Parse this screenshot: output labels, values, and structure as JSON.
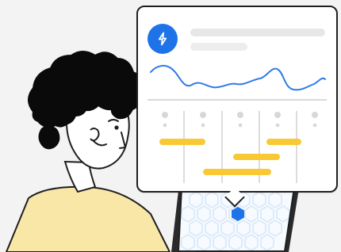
{
  "illustration": {
    "card": {
      "header": {
        "icon": "lightning-bolt-icon",
        "accent": "#1e73e8"
      },
      "chart": {
        "line_color": "#2f7bea",
        "baseline_color": "#d9d9d9"
      },
      "timeline": {
        "column_count": 5,
        "bar_color": "#f8c935",
        "divider_color": "#d9d9d9"
      }
    },
    "person": {
      "hair_color": "#0a0a0a",
      "skin_color": "#ffffff",
      "shirt_color": "#f9e7a8"
    },
    "laptop": {
      "screen_icon": "hexagon-icon",
      "accent": "#1e73e8",
      "pattern_color": "#ddeaf9"
    }
  }
}
